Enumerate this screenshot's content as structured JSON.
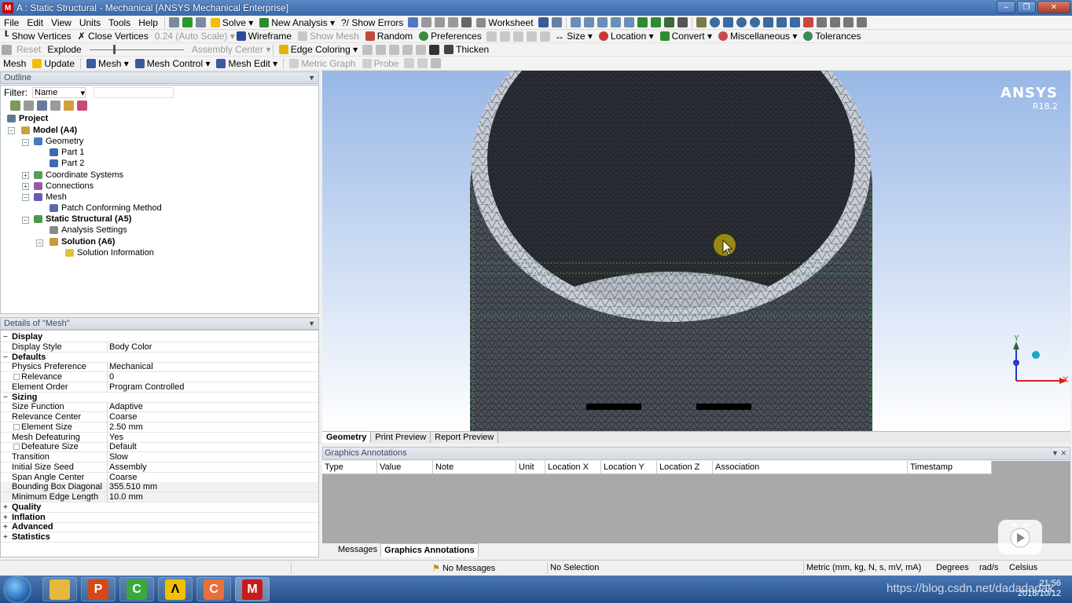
{
  "window": {
    "title": "A : Static Structural - Mechanical [ANSYS Mechanical Enterprise]",
    "app_icon": "M"
  },
  "menu": [
    "File",
    "Edit",
    "View",
    "Units",
    "Tools",
    "Help"
  ],
  "toolbar1": {
    "solve": "Solve",
    "new_analysis": "New Analysis",
    "show_errors": "Show Errors",
    "worksheet": "Worksheet"
  },
  "toolbar2": {
    "show_vertices": "Show Vertices",
    "close_vertices": "Close Vertices",
    "scale": "0.24 (Auto Scale)",
    "wireframe": "Wireframe",
    "show_mesh": "Show Mesh",
    "random": "Random",
    "preferences": "Preferences",
    "size": "Size",
    "location": "Location",
    "convert": "Convert",
    "miscellaneous": "Miscellaneous",
    "tolerances": "Tolerances"
  },
  "toolbar3": {
    "reset": "Reset",
    "explode": "Explode",
    "assembly_center": "Assembly Center",
    "edge_coloring": "Edge Coloring",
    "thicken": "Thicken"
  },
  "toolbar4": {
    "mesh": "Mesh",
    "update": "Update",
    "mesh_menu": "Mesh",
    "mesh_control": "Mesh Control",
    "mesh_edit": "Mesh Edit",
    "metric_graph": "Metric Graph",
    "probe": "Probe"
  },
  "outline": {
    "title": "Outline",
    "filter_label": "Filter:",
    "filter_value": "Name",
    "tree": {
      "project": "Project",
      "model": "Model (A4)",
      "geometry": "Geometry",
      "part1": "Part 1",
      "part2": "Part 2",
      "coordinate_systems": "Coordinate Systems",
      "connections": "Connections",
      "mesh": "Mesh",
      "patch_conforming": "Patch Conforming Method",
      "static_structural": "Static Structural (A5)",
      "analysis_settings": "Analysis Settings",
      "solution": "Solution (A6)",
      "solution_information": "Solution Information"
    }
  },
  "details": {
    "title": "Details of \"Mesh\"",
    "rows": [
      {
        "k": "Display",
        "group": true
      },
      {
        "k": "Display Style",
        "v": "Body Color"
      },
      {
        "k": "Defaults",
        "group": true
      },
      {
        "k": "Physics Preference",
        "v": "Mechanical"
      },
      {
        "k": "Relevance",
        "v": "0",
        "cb": true
      },
      {
        "k": "Element Order",
        "v": "Program Controlled"
      },
      {
        "k": "Sizing",
        "group": true
      },
      {
        "k": "Size Function",
        "v": "Adaptive"
      },
      {
        "k": "Relevance Center",
        "v": "Coarse"
      },
      {
        "k": "Element Size",
        "v": "2.50 mm",
        "cb": true
      },
      {
        "k": "Mesh Defeaturing",
        "v": "Yes"
      },
      {
        "k": "Defeature Size",
        "v": "Default",
        "cb": true
      },
      {
        "k": "Transition",
        "v": "Slow"
      },
      {
        "k": "Initial Size Seed",
        "v": "Assembly"
      },
      {
        "k": "Span Angle Center",
        "v": "Coarse"
      },
      {
        "k": "Bounding Box Diagonal",
        "v": "355.510 mm",
        "shaded": true
      },
      {
        "k": "Minimum Edge Length",
        "v": "10.0 mm",
        "shaded": true
      },
      {
        "k": "Quality",
        "group": true,
        "collapsed": true
      },
      {
        "k": "Inflation",
        "group": true,
        "collapsed": true
      },
      {
        "k": "Advanced",
        "group": true,
        "collapsed": true
      },
      {
        "k": "Statistics",
        "group": true,
        "collapsed": true
      }
    ]
  },
  "viewport": {
    "brand": "ANSYS",
    "version": "R18.2",
    "axis_x": "X",
    "axis_y": "Y",
    "tabs": [
      "Geometry",
      "Print Preview",
      "Report Preview"
    ]
  },
  "annotations": {
    "title": "Graphics Annotations",
    "columns": [
      "Type",
      "Value",
      "Note",
      "Unit",
      "Location X",
      "Location Y",
      "Location Z",
      "Association",
      "Timestamp"
    ],
    "tabs": [
      "Messages",
      "Graphics Annotations"
    ]
  },
  "status": {
    "messages": "No Messages",
    "selection": "No Selection",
    "units": "Metric (mm, kg, N, s, mV, mA)",
    "angle": "Degrees",
    "rotational": "rad/s",
    "temperature": "Celsius"
  },
  "taskbar": {
    "watermark": "https://blog.csdn.net/dadadadak",
    "time": "21:56",
    "date": "2018/10/12"
  }
}
